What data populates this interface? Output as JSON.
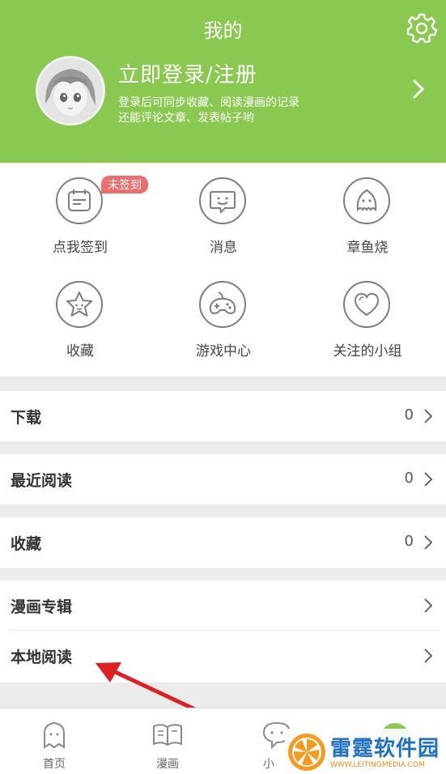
{
  "header": {
    "title": "我的",
    "login_title": "立即登录/注册",
    "login_sub_1": "登录后可同步收藏、阅读漫画的记录",
    "login_sub_2": "还能评论文章、发表帖子哟",
    "bg_color": "#8ac94f"
  },
  "grid": {
    "items": [
      {
        "label": "点我签到",
        "icon": "calendar-icon",
        "badge": "未签到"
      },
      {
        "label": "消息",
        "icon": "message-icon"
      },
      {
        "label": "章鱼烧",
        "icon": "octopus-icon"
      },
      {
        "label": "收藏",
        "icon": "star-icon"
      },
      {
        "label": "游戏中心",
        "icon": "gamepad-icon"
      },
      {
        "label": "关注的小组",
        "icon": "heart-icon"
      }
    ]
  },
  "list": {
    "download": {
      "label": "下载",
      "count": "0"
    },
    "recent": {
      "label": "最近阅读",
      "count": "0"
    },
    "favorites": {
      "label": "收藏",
      "count": "0"
    },
    "albums": {
      "label": "漫画专辑"
    },
    "local": {
      "label": "本地阅读"
    }
  },
  "bottom_nav": [
    {
      "label": "首页",
      "icon": "home-icon"
    },
    {
      "label": "漫画",
      "icon": "book-icon"
    },
    {
      "label": "小",
      "icon": "chat-icon"
    },
    {
      "label": "",
      "icon": "profile-icon"
    }
  ],
  "watermark": {
    "text": "雷霆软件园",
    "url": "WWW.LEITINGMEDIA.COM"
  },
  "colors": {
    "accent": "#8ac94f",
    "badge": "#f06d6d",
    "arrow": "#e02020"
  }
}
